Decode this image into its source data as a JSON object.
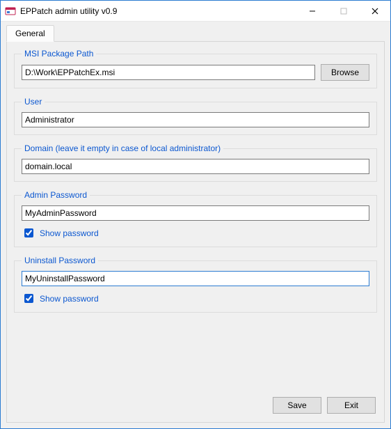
{
  "window": {
    "title": "EPPatch admin utility v0.9"
  },
  "tabs": {
    "general": "General"
  },
  "groups": {
    "msi": {
      "legend": "MSI Package Path",
      "path": "D:\\Work\\EPPatchEx.msi",
      "browse": "Browse"
    },
    "user": {
      "legend": "User",
      "value": "Administrator"
    },
    "domain": {
      "legend": "Domain (leave it empty in case of local administrator)",
      "value": "domain.local"
    },
    "adminpw": {
      "legend": "Admin Password",
      "value": "MyAdminPassword",
      "show": "Show password",
      "show_checked": true
    },
    "uninstpw": {
      "legend": "Uninstall Password",
      "value": "MyUninstallPassword",
      "show": "Show password",
      "show_checked": true
    }
  },
  "buttons": {
    "save": "Save",
    "exit": "Exit"
  }
}
